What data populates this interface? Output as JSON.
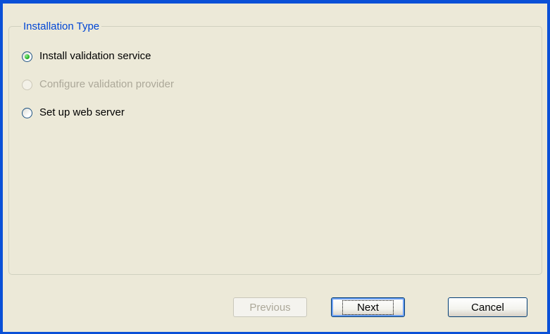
{
  "group": {
    "title": "Installation Type"
  },
  "options": [
    {
      "label": "Install validation service",
      "selected": true,
      "enabled": true
    },
    {
      "label": "Configure validation provider",
      "selected": false,
      "enabled": false
    },
    {
      "label": "Set up web server",
      "selected": false,
      "enabled": true
    }
  ],
  "buttons": {
    "previous": "Previous",
    "next": "Next",
    "cancel": "Cancel"
  },
  "colors": {
    "titlebar_accent": "#0a50d7",
    "background": "#ece9d8",
    "group_title": "#0046d5",
    "disabled_text": "#aca899",
    "radio_selected": "#29b329"
  }
}
